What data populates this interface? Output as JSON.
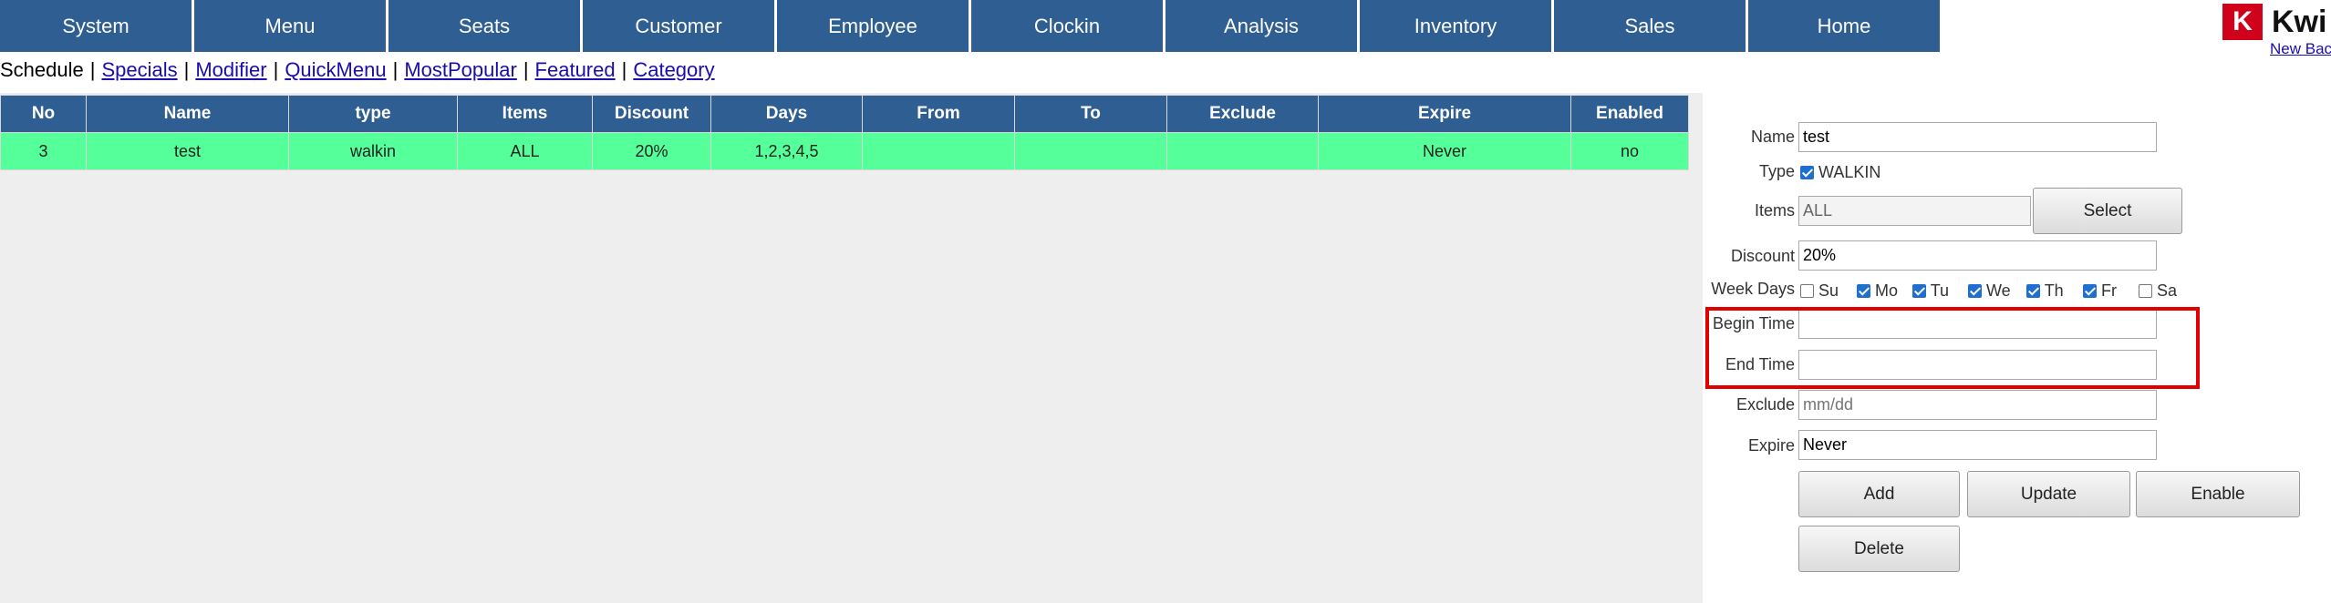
{
  "nav": [
    "System",
    "Menu",
    "Seats",
    "Customer",
    "Employee",
    "Clockin",
    "Analysis",
    "Inventory",
    "Sales",
    "Home"
  ],
  "logo": {
    "letter": "K",
    "text": "Kwi",
    "link": "New Bac"
  },
  "subnav": {
    "current": "Schedule",
    "links": [
      "Specials",
      "Modifier",
      "QuickMenu",
      "MostPopular",
      "Featured",
      "Category"
    ],
    "separator": "|"
  },
  "table": {
    "headers": [
      "No",
      "Name",
      "type",
      "Items",
      "Discount",
      "Days",
      "From",
      "To",
      "Exclude",
      "Expire",
      "Enabled"
    ],
    "rows": [
      [
        "3",
        "test",
        "walkin",
        "ALL",
        "20%",
        "1,2,3,4,5",
        "",
        "",
        "",
        "Never",
        "no"
      ]
    ]
  },
  "form": {
    "name_label": "Name",
    "name_value": "test",
    "type_label": "Type",
    "type_option": "WALKIN",
    "items_label": "Items",
    "items_value": "ALL",
    "select_button": "Select",
    "discount_label": "Discount",
    "discount_value": "20%",
    "weekdays_label": "Week Days",
    "weekdays": [
      {
        "label": "Su",
        "checked": false
      },
      {
        "label": "Mo",
        "checked": true
      },
      {
        "label": "Tu",
        "checked": true
      },
      {
        "label": "We",
        "checked": true
      },
      {
        "label": "Th",
        "checked": true
      },
      {
        "label": "Fr",
        "checked": true
      },
      {
        "label": "Sa",
        "checked": false
      }
    ],
    "begin_label": "Begin Time",
    "begin_value": "",
    "end_label": "End Time",
    "end_value": "",
    "exclude_label": "Exclude",
    "exclude_placeholder": "mm/dd",
    "expire_label": "Expire",
    "expire_value": "Never",
    "buttons": {
      "add": "Add",
      "update": "Update",
      "enable": "Enable",
      "delete": "Delete"
    }
  },
  "colors": {
    "nav": "#2f5e92",
    "row": "#55ff99",
    "panel": "#eeeeee",
    "highlight": "#e00000",
    "logo": "#d0021b"
  }
}
